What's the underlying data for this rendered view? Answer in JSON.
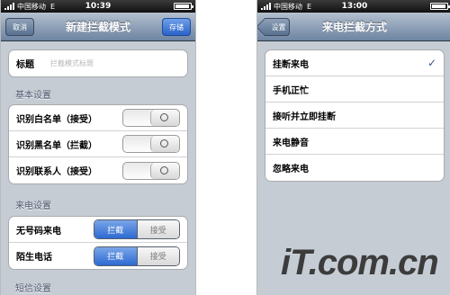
{
  "left_phone": {
    "status": {
      "carrier": "中国移动",
      "network": "E",
      "time": "10:39"
    },
    "nav": {
      "cancel": "取消",
      "title": "新建拦截模式",
      "save": "存储"
    },
    "title_row": {
      "label": "标题",
      "placeholder": "拦截模式标题"
    },
    "basic_section": "基本设置",
    "basic_rows": [
      "识别白名单（接受）",
      "识别黑名单（拦截）",
      "识别联系人（接受）"
    ],
    "call_section": "来电设置",
    "call_rows": [
      {
        "label": "无号码来电",
        "on": "拦截",
        "off": "接受"
      },
      {
        "label": "陌生电话",
        "on": "拦截",
        "off": "接受"
      }
    ],
    "sms_section": "短信设置"
  },
  "right_phone": {
    "status": {
      "carrier": "中国移动",
      "network": "E",
      "time": "13:00"
    },
    "nav": {
      "back": "设置",
      "title": "来电拦截方式"
    },
    "options": [
      "挂断来电",
      "手机正忙",
      "接听并立即挂断",
      "来电静音",
      "忽略来电"
    ],
    "selected_mark": "✓"
  },
  "watermark": "iT.com.cn"
}
